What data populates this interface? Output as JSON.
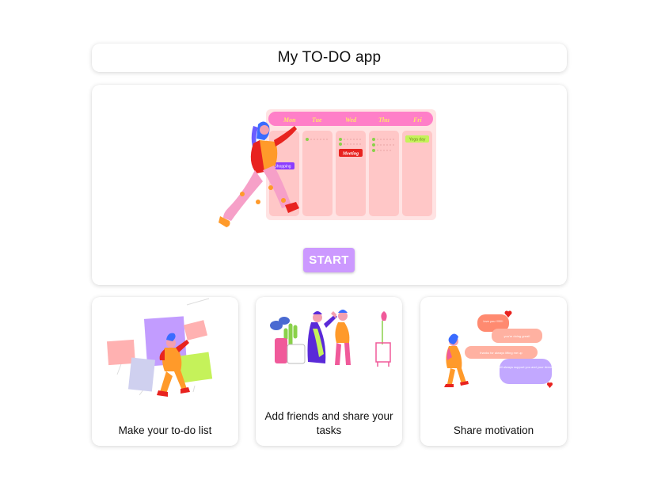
{
  "app": {
    "title": "My TO-DO app"
  },
  "hero": {
    "start_label": "START",
    "planner": {
      "days": [
        "Mon",
        "Tue",
        "Wed",
        "Thu",
        "Fri"
      ],
      "tags": [
        "Meeting",
        "Shopping",
        "Yoga day"
      ]
    }
  },
  "features": [
    {
      "label": "Make your to-do list",
      "illustration": "person-with-sticky-notes-icon"
    },
    {
      "label": "Add friends and share your tasks",
      "illustration": "friends-high-five-icon"
    },
    {
      "label": "Share motivation",
      "illustration": "chat-bubbles-icon",
      "messages": [
        "love you !!!!!!!!",
        "you're doing great!",
        "thanks for always lifting me up",
        "I will always support you and your dreams"
      ]
    }
  ],
  "colors": {
    "accent": "#cc99ff",
    "planner_bg": "#ffc7c7",
    "planner_header": "#ff7fc8",
    "red_tag": "#e8231f",
    "purple_tag": "#8a3cff",
    "lime": "#c5f25a"
  }
}
